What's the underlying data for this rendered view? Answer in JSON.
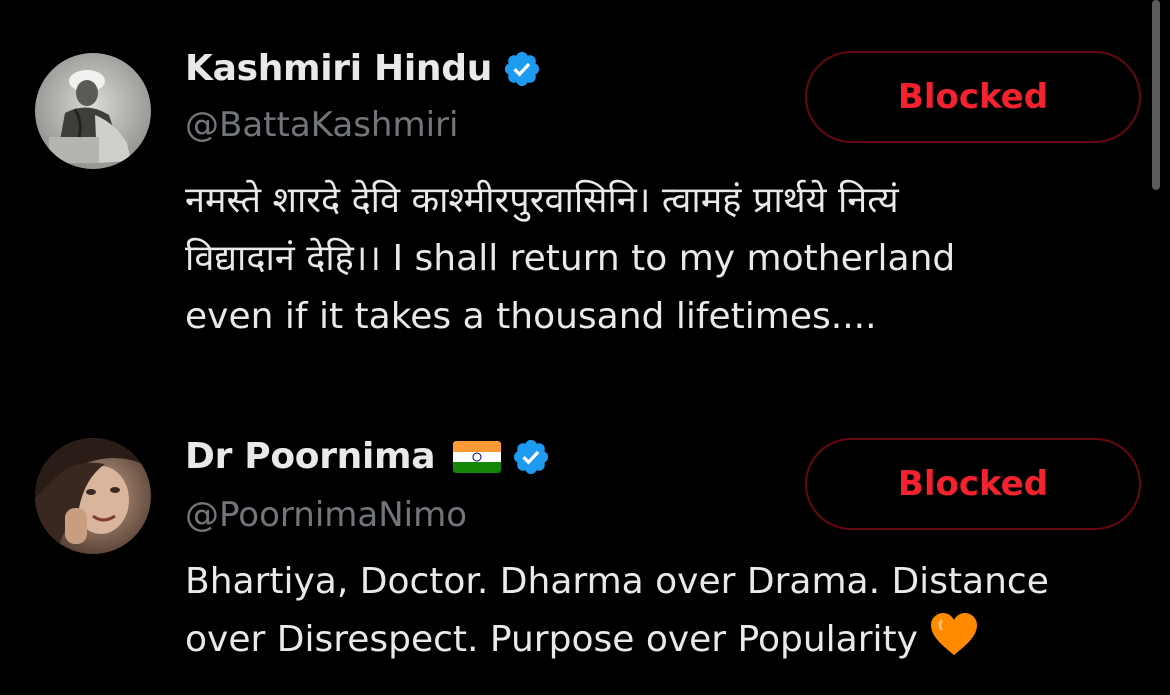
{
  "users": [
    {
      "display_name": "Kashmiri Hindu",
      "handle": "@BattaKashmiri",
      "verified_icon": "verified-badge-icon",
      "bio_lines": [
        "नमस्ते शारदे देवि काश्मीरपुरवासिनि। त्वामहं प्रार्थये नित्यं",
        "विद्यादानं देहि।। I shall return to my motherland",
        "even if it takes a thousand lifetimes...."
      ],
      "button_label": "Blocked"
    },
    {
      "display_name": "Dr Poornima",
      "flag_icon": "india-flag-icon",
      "handle": "@PoornimaNimo",
      "verified_icon": "verified-badge-icon",
      "bio_lines": [
        "Bhartiya, Doctor. Dharma over Drama. Distance",
        "over Disrespect. Purpose over Popularity"
      ],
      "bio_emoji": "orange-heart-icon",
      "button_label": "Blocked"
    }
  ],
  "colors": {
    "background": "#000000",
    "primary_text": "#e7e9ea",
    "secondary_text": "#71767b",
    "blocked_red": "#f4212e",
    "blocked_border": "#67070f",
    "verified_blue": "#1d9bf0",
    "heart_orange": "#ff8a00"
  }
}
